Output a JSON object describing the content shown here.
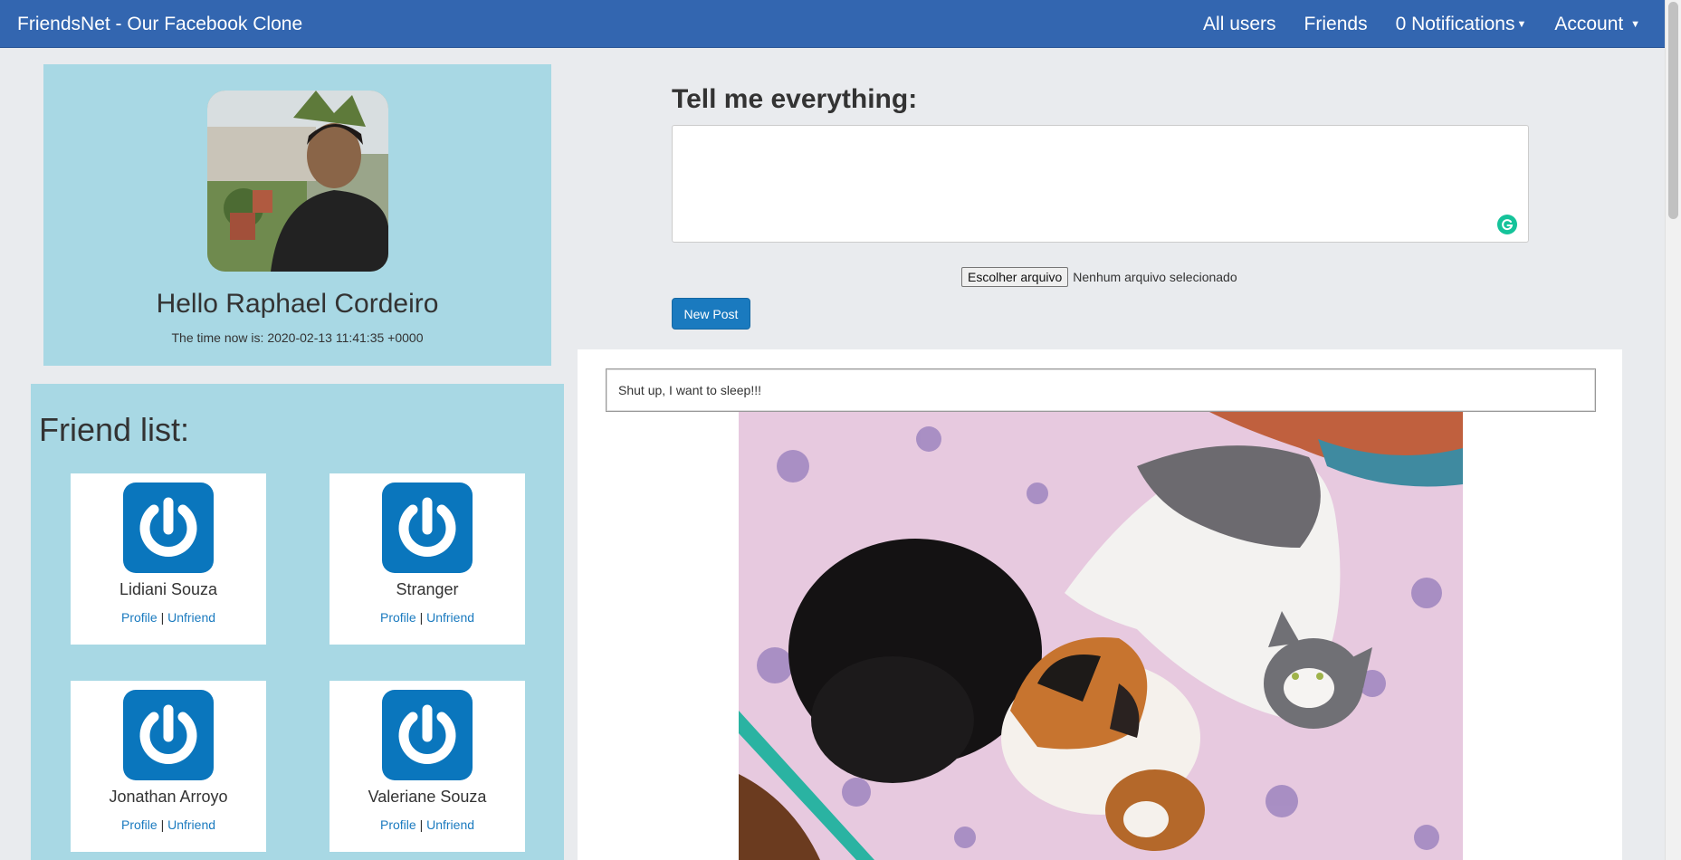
{
  "navbar": {
    "brand": "FriendsNet - Our Facebook Clone",
    "all_users": "All users",
    "friends": "Friends",
    "notifications": "0 Notifications",
    "account": "Account",
    "color": "#3366b0"
  },
  "profile": {
    "greeting": "Hello Raphael Cordeiro",
    "time": "The time now is: 2020-02-13 11:41:35 +0000"
  },
  "friends_panel": {
    "title": "Friend list:",
    "friends": [
      {
        "name": "Lidiani Souza",
        "profile_link": "Profile",
        "separator": "|",
        "unfriend_link": "Unfriend"
      },
      {
        "name": "Stranger",
        "profile_link": "Profile",
        "separator": "|",
        "unfriend_link": "Unfriend"
      },
      {
        "name": "Jonathan Arroyo",
        "profile_link": "Profile",
        "separator": "|",
        "unfriend_link": "Unfriend"
      },
      {
        "name": "Valeriane Souza",
        "profile_link": "Profile",
        "separator": "|",
        "unfriend_link": "Unfriend"
      }
    ]
  },
  "post_form": {
    "title": "Tell me everything:",
    "textarea_value": "",
    "file_button": "Escolher arquivo",
    "file_status": "Nenhum arquivo selecionado",
    "submit": "New Post"
  },
  "feed": {
    "posts": [
      {
        "text": "Shut up, I want to sleep!!!"
      }
    ]
  }
}
